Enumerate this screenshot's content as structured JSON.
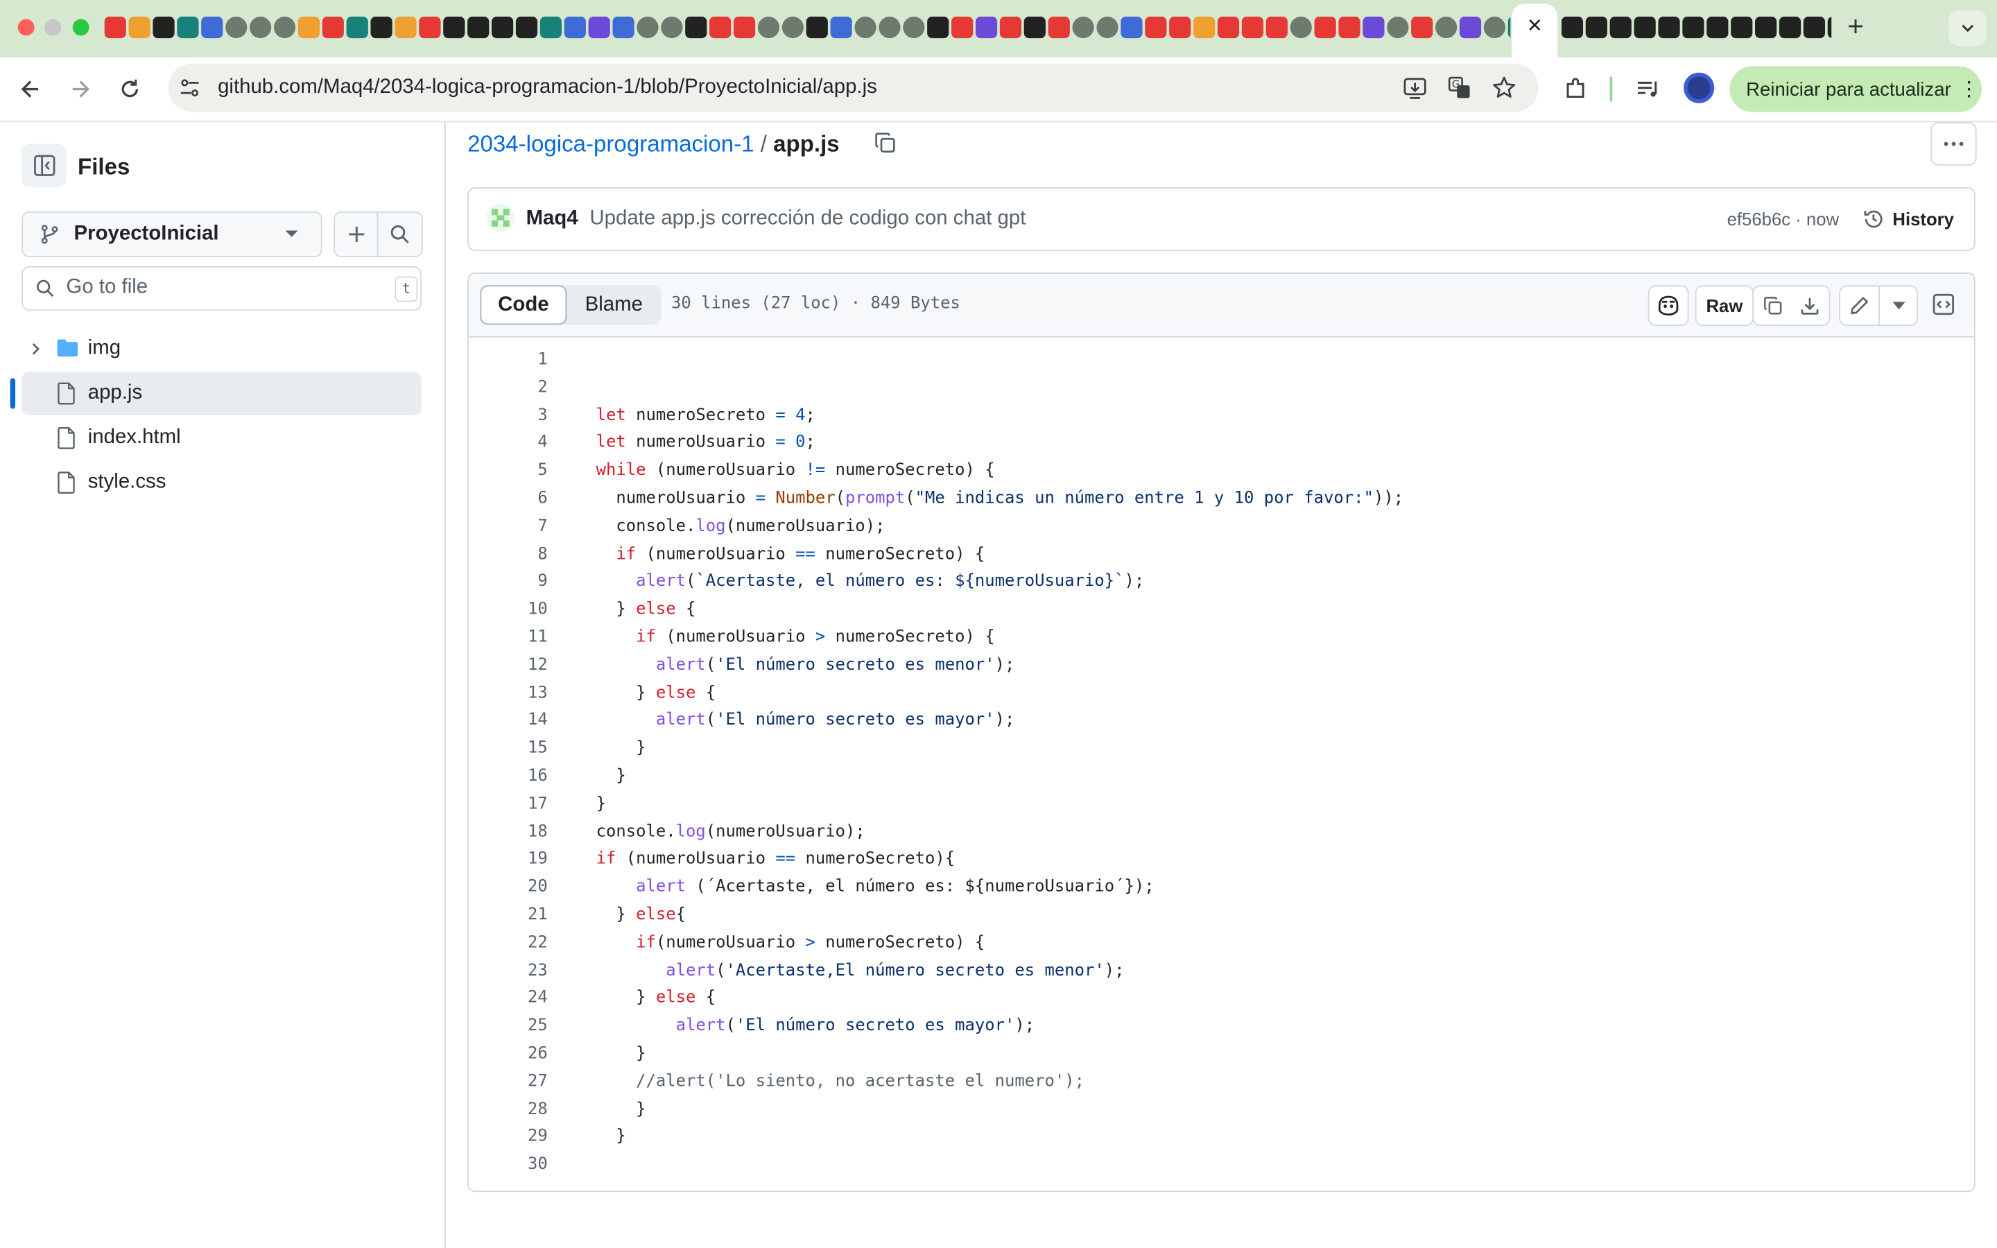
{
  "browser": {
    "url": "github.com/Maq4/2034-logica-programacion-1/blob/ProyectoInicial/app.js",
    "update_label": "Reiniciar para actualizar"
  },
  "sidebar": {
    "title": "Files",
    "branch": "ProyectoInicial",
    "goto_placeholder": "Go to file",
    "goto_shortcut": "t",
    "tree": [
      {
        "name": "img",
        "type": "folder"
      },
      {
        "name": "app.js",
        "type": "file",
        "selected": true
      },
      {
        "name": "index.html",
        "type": "file"
      },
      {
        "name": "style.css",
        "type": "file"
      }
    ]
  },
  "breadcrumb": {
    "repo": "2034-logica-programacion-1",
    "separator": "/",
    "file": "app.js"
  },
  "commit": {
    "author": "Maq4",
    "message": "Update app.js corrección de codigo con chat gpt",
    "hash_time": "ef56b6c · now",
    "history_label": "History"
  },
  "file_header": {
    "code_tab": "Code",
    "blame_tab": "Blame",
    "meta": "30 lines (27 loc) · 849 Bytes",
    "raw_label": "Raw"
  },
  "code_lines": [
    [],
    [],
    [
      [
        "kw",
        "let"
      ],
      [
        "t",
        " numeroSecreto "
      ],
      [
        "op",
        "="
      ],
      [
        "t",
        " "
      ],
      [
        "num",
        "4"
      ],
      [
        "t",
        ";"
      ]
    ],
    [
      [
        "kw",
        "let"
      ],
      [
        "t",
        " numeroUsuario "
      ],
      [
        "op",
        "="
      ],
      [
        "t",
        " "
      ],
      [
        "num",
        "0"
      ],
      [
        "t",
        ";"
      ]
    ],
    [
      [
        "kw",
        "while"
      ],
      [
        "t",
        " (numeroUsuario "
      ],
      [
        "op",
        "!="
      ],
      [
        "t",
        " numeroSecreto) {"
      ]
    ],
    [
      [
        "t",
        "  numeroUsuario "
      ],
      [
        "op",
        "="
      ],
      [
        "t",
        " "
      ],
      [
        "builtin",
        "Number"
      ],
      [
        "t",
        "("
      ],
      [
        "fn",
        "prompt"
      ],
      [
        "t",
        "("
      ],
      [
        "str",
        "\"Me indicas un número entre 1 y 10 por favor:\""
      ],
      [
        "t",
        "));"
      ]
    ],
    [
      [
        "t",
        "  console."
      ],
      [
        "fn",
        "log"
      ],
      [
        "t",
        "(numeroUsuario);"
      ]
    ],
    [
      [
        "t",
        "  "
      ],
      [
        "kw",
        "if"
      ],
      [
        "t",
        " (numeroUsuario "
      ],
      [
        "op",
        "=="
      ],
      [
        "t",
        " numeroSecreto) {"
      ]
    ],
    [
      [
        "t",
        "    "
      ],
      [
        "fn",
        "alert"
      ],
      [
        "t",
        "("
      ],
      [
        "str",
        "`Acertaste, el número es: ${numeroUsuario}`"
      ],
      [
        "t",
        ");"
      ]
    ],
    [
      [
        "t",
        "  } "
      ],
      [
        "kw",
        "else"
      ],
      [
        "t",
        " {"
      ]
    ],
    [
      [
        "t",
        "    "
      ],
      [
        "kw",
        "if"
      ],
      [
        "t",
        " (numeroUsuario "
      ],
      [
        "op",
        ">"
      ],
      [
        "t",
        " numeroSecreto) {"
      ]
    ],
    [
      [
        "t",
        "      "
      ],
      [
        "fn",
        "alert"
      ],
      [
        "t",
        "("
      ],
      [
        "str",
        "'El número secreto es menor'"
      ],
      [
        "t",
        ");"
      ]
    ],
    [
      [
        "t",
        "    } "
      ],
      [
        "kw",
        "else"
      ],
      [
        "t",
        " {"
      ]
    ],
    [
      [
        "t",
        "      "
      ],
      [
        "fn",
        "alert"
      ],
      [
        "t",
        "("
      ],
      [
        "str",
        "'El número secreto es mayor'"
      ],
      [
        "t",
        ");"
      ]
    ],
    [
      [
        "t",
        "    }"
      ]
    ],
    [
      [
        "t",
        "  }"
      ]
    ],
    [
      [
        "t",
        "}"
      ]
    ],
    [
      [
        "t",
        "console."
      ],
      [
        "fn",
        "log"
      ],
      [
        "t",
        "(numeroUsuario);"
      ]
    ],
    [
      [
        "kw",
        "if"
      ],
      [
        "t",
        " (numeroUsuario "
      ],
      [
        "op",
        "=="
      ],
      [
        "t",
        " numeroSecreto){"
      ]
    ],
    [
      [
        "t",
        "    "
      ],
      [
        "fn",
        "alert"
      ],
      [
        "t",
        " (´Acertaste, el número es: ${numeroUsuario´});"
      ]
    ],
    [
      [
        "t",
        "  } "
      ],
      [
        "kw",
        "else"
      ],
      [
        "t",
        "{"
      ]
    ],
    [
      [
        "t",
        "    "
      ],
      [
        "kw",
        "if"
      ],
      [
        "t",
        "(numeroUsuario "
      ],
      [
        "op",
        ">"
      ],
      [
        "t",
        " numeroSecreto) {"
      ]
    ],
    [
      [
        "t",
        "       "
      ],
      [
        "fn",
        "alert"
      ],
      [
        "t",
        "("
      ],
      [
        "str",
        "'Acertaste,El número secreto es menor'"
      ],
      [
        "t",
        ");"
      ]
    ],
    [
      [
        "t",
        "    } "
      ],
      [
        "kw",
        "else"
      ],
      [
        "t",
        " {"
      ]
    ],
    [
      [
        "t",
        "        "
      ],
      [
        "fn",
        "alert"
      ],
      [
        "t",
        "("
      ],
      [
        "str",
        "'El número secreto es mayor'"
      ],
      [
        "t",
        ");"
      ]
    ],
    [
      [
        "t",
        "    }"
      ]
    ],
    [
      [
        "t",
        "    "
      ],
      [
        "cm",
        "//alert('Lo siento, no acertaste el numero');"
      ]
    ],
    [
      [
        "t",
        "    }"
      ]
    ],
    [
      [
        "t",
        "  }"
      ]
    ],
    []
  ]
}
